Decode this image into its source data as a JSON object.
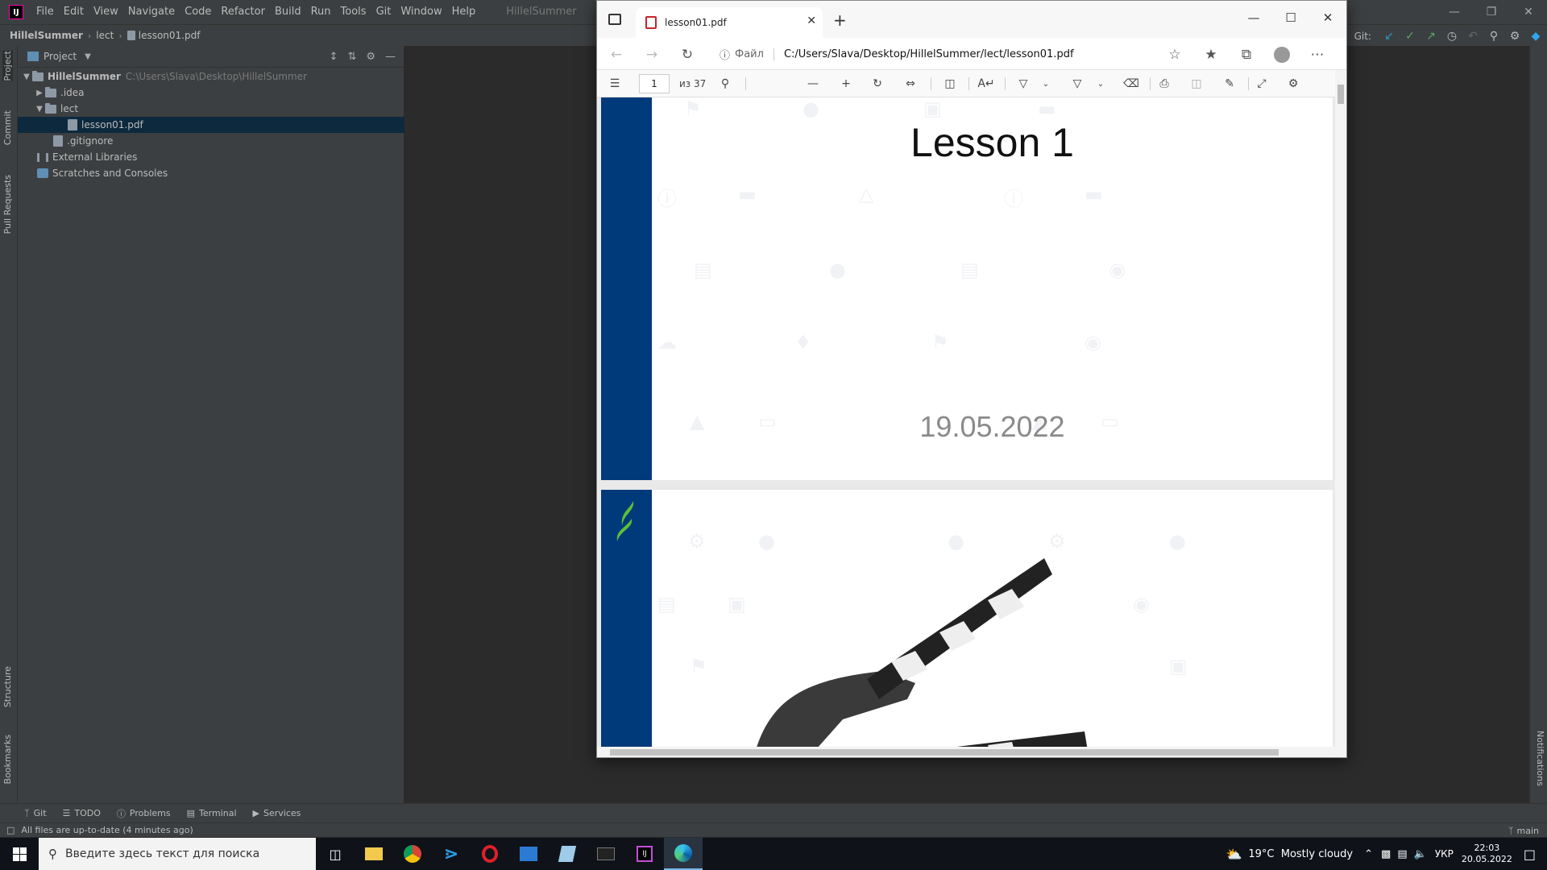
{
  "ide": {
    "menu": [
      "File",
      "Edit",
      "View",
      "Navigate",
      "Code",
      "Refactor",
      "Build",
      "Run",
      "Tools",
      "Git",
      "Window",
      "Help"
    ],
    "project_title": "HillelSummer",
    "breadcrumb": [
      "HillelSummer",
      "lect",
      "lesson01.pdf"
    ],
    "git_label": "Git:",
    "left_tabs": [
      "Project",
      "Commit",
      "Pull Requests",
      "Structure",
      "Bookmarks"
    ],
    "right_tabs": [
      "Notifications"
    ],
    "panel_title": "Project",
    "tree": [
      {
        "label": "HillelSummer",
        "path": "C:\\Users\\Slava\\Desktop\\HillelSummer"
      },
      {
        "label": ".idea"
      },
      {
        "label": "lect"
      },
      {
        "label": "lesson01.pdf"
      },
      {
        "label": ".gitignore"
      },
      {
        "label": "External Libraries"
      },
      {
        "label": "Scratches and Consoles"
      }
    ],
    "bottom_tabs": [
      "Git",
      "TODO",
      "Problems",
      "Terminal",
      "Services"
    ],
    "status_text": "All files are up-to-date (4 minutes ago)",
    "branch": "main",
    "colors": {
      "background": "#2b2b2b",
      "panel": "#3c3f41",
      "selection": "#0d293e"
    }
  },
  "browser": {
    "tab_title": "lesson01.pdf",
    "address_label": "Файл",
    "url": "C:/Users/Slava/Desktop/HillelSummer/lect/lesson01.pdf",
    "pdf": {
      "page_current": "1",
      "page_total": "из 37",
      "page1_title": "Lesson 1",
      "page1_date": "19.05.2022",
      "accent": "#003a7b"
    }
  },
  "taskbar": {
    "search_placeholder": "Введите здесь текст для поиска",
    "weather": "19°C  Mostly cloudy",
    "lang": "УКР",
    "time": "22:03",
    "date": "20.05.2022"
  }
}
